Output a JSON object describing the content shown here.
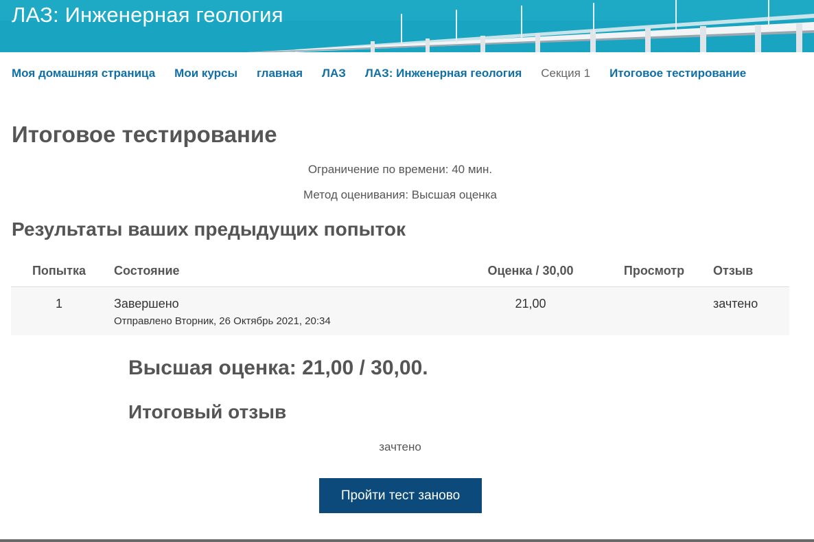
{
  "banner": {
    "title": "ЛАЗ: Инженерная геология",
    "image": "bridge-over-sea"
  },
  "breadcrumb": [
    {
      "label": "Моя домашняя страница",
      "link": true
    },
    {
      "label": "Мои курсы",
      "link": true
    },
    {
      "label": "главная",
      "link": true
    },
    {
      "label": "ЛАЗ",
      "link": true
    },
    {
      "label": "ЛАЗ: Инженерная геология",
      "link": true
    },
    {
      "label": "Секция 1",
      "link": false
    },
    {
      "label": "Итоговое тестирование",
      "link": true
    }
  ],
  "quiz": {
    "title": "Итоговое тестирование",
    "time_limit": "Ограничение по времени: 40 мин.",
    "grading_method": "Метод оценивания: Высшая оценка"
  },
  "results": {
    "title": "Результаты ваших предыдущих попыток",
    "columns": {
      "attempt": "Попытка",
      "state": "Состояние",
      "grade": "Оценка / 30,00",
      "review": "Просмотр",
      "feedback": "Отзыв"
    },
    "rows": [
      {
        "attempt": "1",
        "state": "Завершено",
        "submitted": "Отправлено Вторник, 26 Октябрь 2021, 20:34",
        "grade": "21,00",
        "review": "",
        "feedback": "зачтено"
      }
    ]
  },
  "summary": {
    "best_grade": "Высшая оценка: 21,00 / 30,00.",
    "final_feedback_title": "Итоговый отзыв",
    "final_feedback_text": "зачтено"
  },
  "actions": {
    "retry_label": "Пройти тест заново"
  },
  "colors": {
    "link": "#0f6fa6",
    "button": "#0b4a7a",
    "text": "#555555",
    "banner": "#1aa7c2"
  }
}
